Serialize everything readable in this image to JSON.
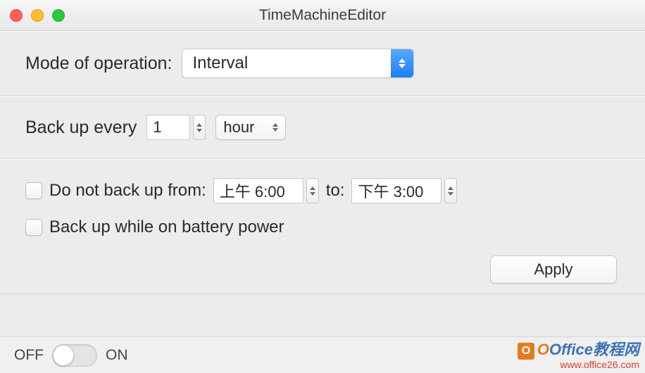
{
  "window": {
    "title": "TimeMachineEditor"
  },
  "mode": {
    "label": "Mode of operation:",
    "selected": "Interval"
  },
  "interval": {
    "label": "Back up every",
    "value": "1",
    "unit": "hour"
  },
  "exclude": {
    "label": "Do not back up from:",
    "from": "上午 6:00",
    "to_label": "to:",
    "to": "下午 3:00",
    "checked": false
  },
  "battery": {
    "label": "Back up while on battery power",
    "checked": false
  },
  "apply": {
    "label": "Apply"
  },
  "toggle": {
    "off": "OFF",
    "on": "ON",
    "state": "off"
  },
  "watermark": {
    "line1": "Office教程网",
    "line2": "www.office26.com"
  }
}
